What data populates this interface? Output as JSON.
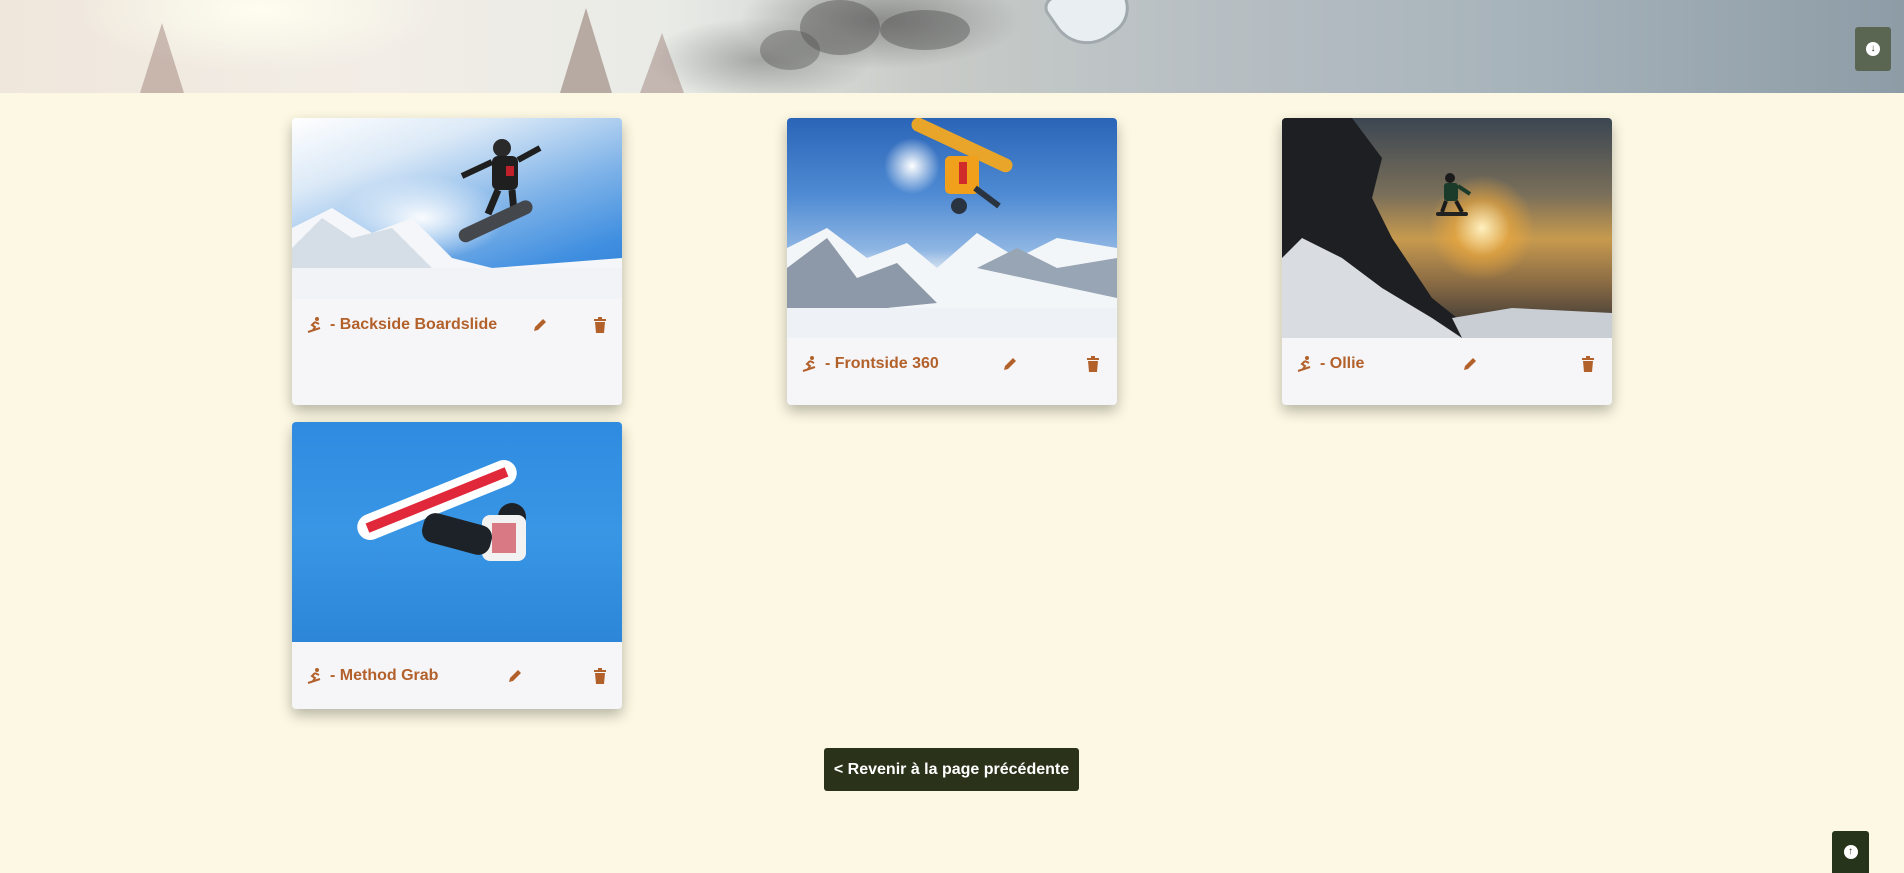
{
  "header": {
    "scroll_down_icon": "arrow-circle-down-icon"
  },
  "tricks": [
    {
      "name": "- Backside Boardslide",
      "icon": "snowboarding-icon",
      "edit_icon": "pencil-icon",
      "delete_icon": "trash-icon"
    },
    {
      "name": "- Frontside 360",
      "icon": "snowboarding-icon",
      "edit_icon": "pencil-icon",
      "delete_icon": "trash-icon"
    },
    {
      "name": "- Ollie",
      "icon": "snowboarding-icon",
      "edit_icon": "pencil-icon",
      "delete_icon": "trash-icon"
    },
    {
      "name": "- Method Grab",
      "icon": "snowboarding-icon",
      "edit_icon": "pencil-icon",
      "delete_icon": "trash-icon"
    }
  ],
  "footer": {
    "back_label": "< Revenir à la page précédente",
    "scroll_up_icon": "arrow-circle-up-icon"
  },
  "colors": {
    "background": "#fcf8e3",
    "accent": "#b3612b",
    "button_dark": "#2a331a"
  }
}
